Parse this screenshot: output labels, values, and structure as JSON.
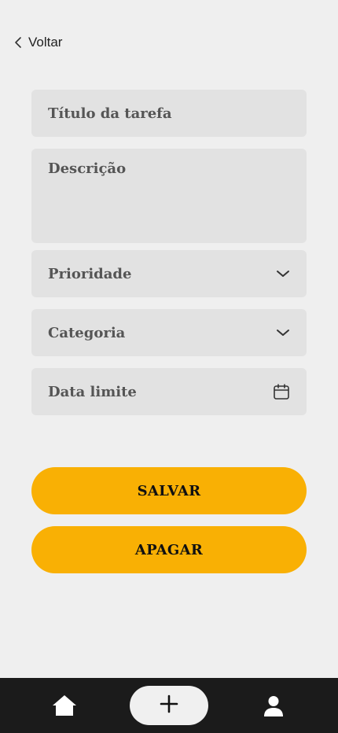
{
  "header": {
    "back_label": "Voltar",
    "back_icon": "chevron-left-icon"
  },
  "form": {
    "title_placeholder": "Título da tarefa",
    "description_placeholder": "Descrição",
    "priority_placeholder": "Prioridade",
    "category_placeholder": "Categoria",
    "due_date_placeholder": "Data limite"
  },
  "actions": {
    "save_label": "SALVAR",
    "delete_label": "APAGAR"
  },
  "bottom_nav": {
    "items": [
      "home-icon",
      "plus-icon",
      "user-icon"
    ]
  },
  "colors": {
    "background": "#efefef",
    "field": "#e2e2e2",
    "accent": "#f9b004",
    "navbar": "#1b1b1b",
    "add_button": "#f0f0f0"
  }
}
